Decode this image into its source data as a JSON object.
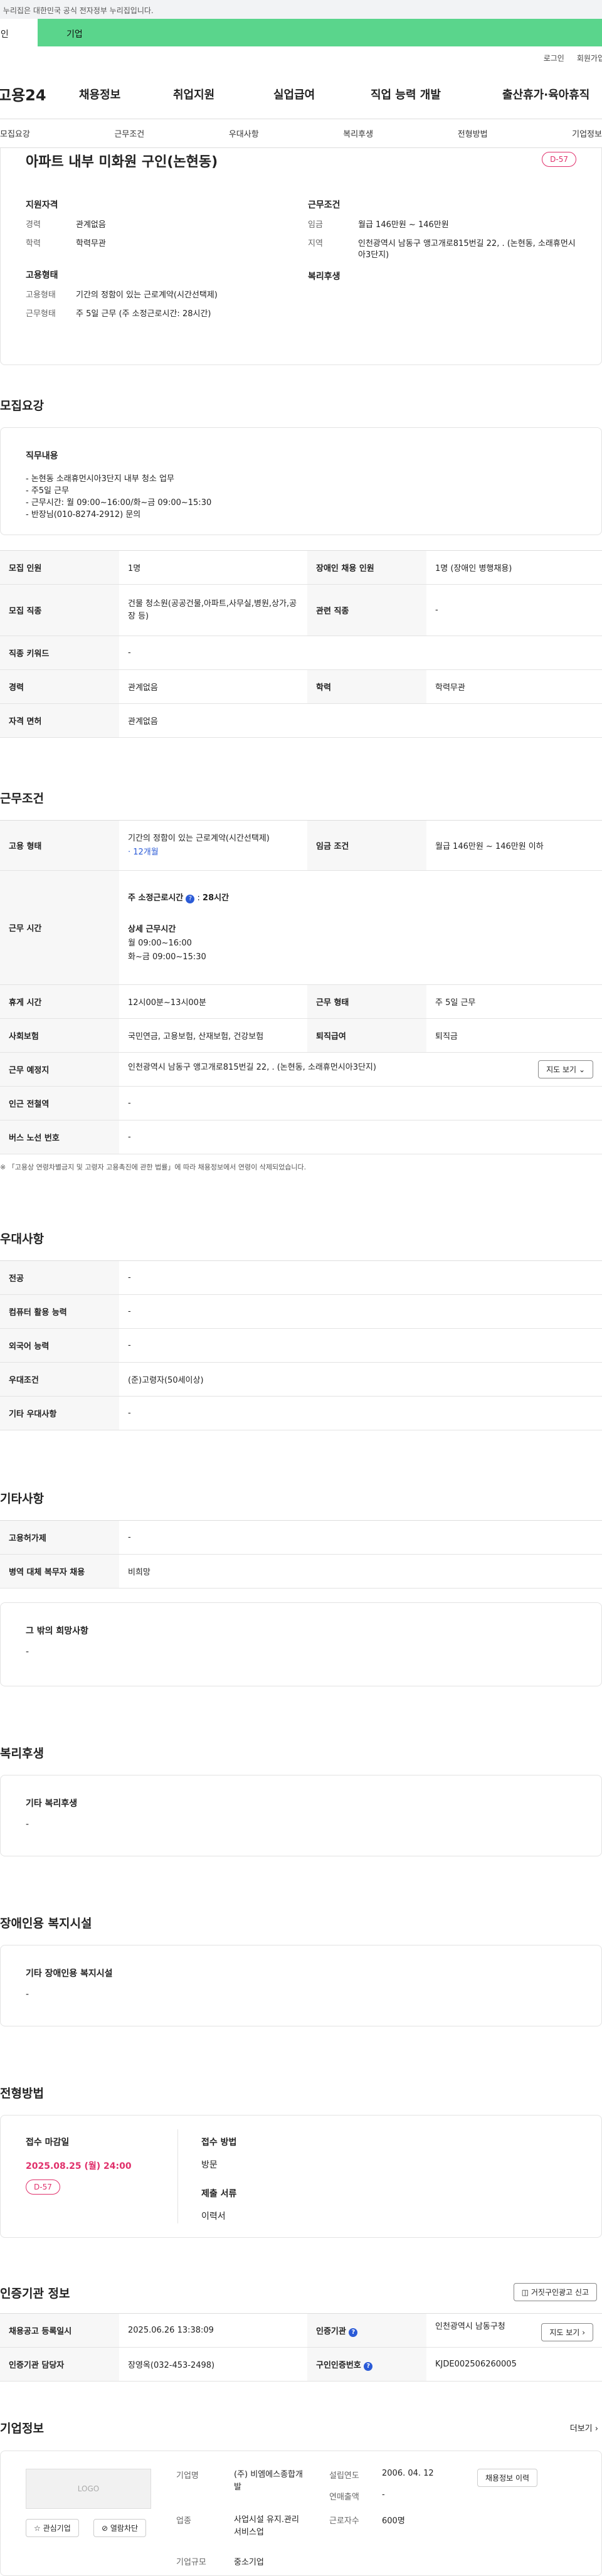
{
  "gov_banner": "이 누리집은 대한민국 공식 전자정부 누리집입니다.",
  "tabs": {
    "personal": "개인",
    "company": "기업"
  },
  "util": {
    "login": "로그인",
    "join": "회원가입"
  },
  "logo": "고용24",
  "gnb": [
    "채용정보",
    "취업지원",
    "실업급여",
    "직업 능력 개발",
    "출산휴가·육아휴직"
  ],
  "section_tabs": [
    "모집요강",
    "근무조건",
    "우대사항",
    "복리후생",
    "전형방법",
    "기업정보"
  ],
  "job": {
    "title": "아파트 내부 미화원 구인(논현동)",
    "dday": "D-57",
    "qual_head": "지원자격",
    "career_k": "경력",
    "career_v": "관계없음",
    "edu_k": "학력",
    "edu_v": "학력무관",
    "emp_head": "고용형태",
    "emptype_k": "고용형태",
    "emptype_v": "기간의 정함이 있는 근로계약(시간선택제)",
    "worktype_k": "근무형태",
    "worktype_v": "주 5일 근무 (주 소정근로시간: 28시간)",
    "cond_head": "근무조건",
    "wage_k": "임금",
    "wage_v": "월급 146만원 ~ 146만원",
    "area_k": "지역",
    "area_v": "인천광역시 남동구 앵고개로815번길 22, . (논현동, 소래휴먼시아3단지)",
    "welfare_head": "복리후생"
  },
  "recruit": {
    "title": "모집요강",
    "duty_head": "직무내용",
    "duty_lines": [
      "- 논현동 소래휴먼시아3단지 내부 청소 업무",
      "- 주5일 근무",
      "- 근무시간: 월 09:00~16:00/화~금 09:00~15:30",
      "- 반장님(010-8274-2912) 문의"
    ],
    "rows": {
      "count_k": "모집 인원",
      "count_v": "1명",
      "disabled_k": "장애인 채용 인원",
      "disabled_v": "1명 (장애인 병행채용)",
      "job_k": "모집 직종",
      "job_v": "건물 청소원(공공건물,아파트,사무실,병원,상가,공장 등)",
      "related_k": "관련 직종",
      "related_v": "-",
      "keyword_k": "직종 키워드",
      "keyword_v": "-",
      "career_k": "경력",
      "career_v": "관계없음",
      "edu_k": "학력",
      "edu_v": "학력무관",
      "license_k": "자격 면허",
      "license_v": "관계없음"
    }
  },
  "work": {
    "title": "근무조건",
    "emp_k": "고용 형태",
    "emp_v": "기간의 정함이 있는 근로계약(시간선택제)",
    "emp_period": "· 12개월",
    "wage_k": "임금 조건",
    "wage_v": "월급 146만원 ~ 146만원 이하",
    "hours_k": "근무 시간",
    "hours_contract_k": "주 소정근로시간",
    "hours_contract_v": "28시간",
    "hours_detail_k": "상세 근무시간",
    "hours_detail_1": "월 09:00~16:00",
    "hours_detail_2": "화~금 09:00~15:30",
    "break_k": "휴게 시간",
    "break_v": "12시00분~13시00분",
    "form_k": "근무 형태",
    "form_v": "주 5일 근무",
    "ins_k": "사회보험",
    "ins_v": "국민연금, 고용보험, 산재보험, 건강보험",
    "retire_k": "퇴직급여",
    "retire_v": "퇴직금",
    "place_k": "근무 예정지",
    "place_v": "인천광역시 남동구 앵고개로815번길 22, . (논현동, 소래휴먼시아3단지)",
    "map_btn": "지도 보기",
    "subway_k": "인근 전철역",
    "subway_v": "-",
    "bus_k": "버스 노선 번호",
    "bus_v": "-",
    "note": "※ 「고용상 연령차별금지 및 고령자 고용촉진에 관한 법률」에 따라 채용정보에서 연령이 삭제되었습니다."
  },
  "pref": {
    "title": "우대사항",
    "major_k": "전공",
    "major_v": "-",
    "pc_k": "컴퓨터 활용 능력",
    "pc_v": "-",
    "lang_k": "외국어 능력",
    "lang_v": "-",
    "cond_k": "우대조건",
    "cond_v": "(준)고령자(50세이상)",
    "other_k": "기타 우대사항",
    "other_v": "-"
  },
  "etc": {
    "title": "기타사항",
    "pay_k": "고용허가제",
    "pay_v": "-",
    "military_k": "병역 대체 복무자 채용",
    "military_v": "비희망",
    "wish_head": "그 밖의 희망사항",
    "wish_v": "-"
  },
  "welfare": {
    "title": "복리후생",
    "head": "기타 복리후생",
    "value": "-"
  },
  "disabled_fac": {
    "title": "장애인용 복지시설",
    "head": "기타 장애인용 복지시설",
    "value": "-"
  },
  "selection": {
    "title": "전형방법",
    "deadline_head": "접수 마감일",
    "deadline_v": "2025.08.25 (월) 24:00",
    "dday": "D-57",
    "method_head": "접수 방법",
    "method_v": "방문",
    "docs_head": "제출 서류",
    "docs_v": "이력서"
  },
  "agency": {
    "title": "인증기관 정보",
    "report_btn": "거짓구인광고 신고",
    "regdate_k": "채용공고 등록일시",
    "regdate_v": "2025.06.26 13:38:09",
    "agency_k": "인증기관",
    "agency_v": "인천광역시 남동구청",
    "map_btn": "지도 보기",
    "manager_k": "인증기관 담당자",
    "manager_v": "장영옥(032-453-2498)",
    "authno_k": "구인인증번호",
    "authno_v": "KJDE002506260005"
  },
  "company": {
    "title": "기업정보",
    "more": "더보기",
    "logo_text": "LOGO",
    "fav_btn": "관심기업",
    "block_btn": "열람차단",
    "name_k": "기업명",
    "name_v": "(주) 비엠에스종합개발",
    "est_k": "설립연도",
    "est_v": "2006. 04. 12",
    "sales_k": "연매출액",
    "sales_v": "-",
    "biz_k": "업종",
    "biz_v": "사업시설 유지.관리 서비스업",
    "emp_k": "근로자수",
    "emp_v": "600명",
    "size_k": "기업규모",
    "size_v": "중소기업",
    "jobs_btn": "채용정보 이력"
  }
}
